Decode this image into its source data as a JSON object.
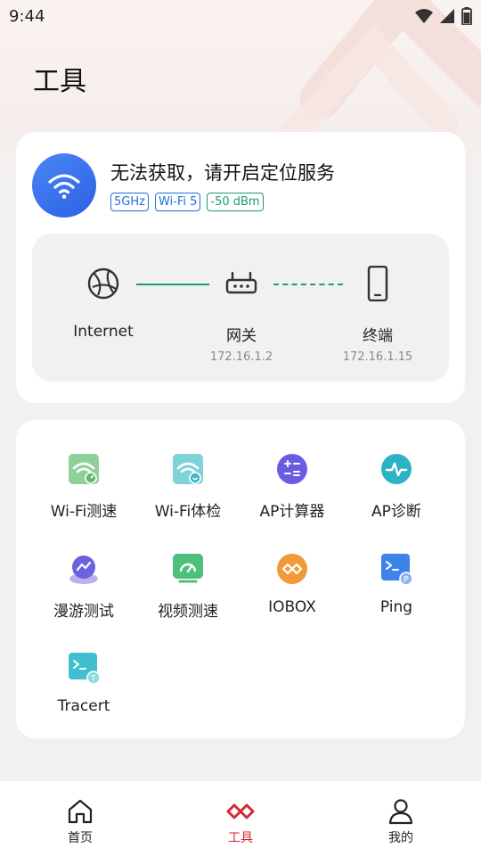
{
  "status_bar": {
    "time": "9:44"
  },
  "page": {
    "title": "工具"
  },
  "network": {
    "status_text": "无法获取，请开启定位服务",
    "badges": [
      "5GHz",
      "Wi-Fi 5",
      "-50 dBm"
    ],
    "topology": {
      "internet_label": "Internet",
      "gateway_label": "网关",
      "gateway_ip": "172.16.1.2",
      "terminal_label": "终端",
      "terminal_ip": "172.16.1.15"
    }
  },
  "tools": [
    {
      "label": "Wi-Fi测速",
      "icon": "wifi-speed-icon"
    },
    {
      "label": "Wi-Fi体检",
      "icon": "wifi-checkup-icon"
    },
    {
      "label": "AP计算器",
      "icon": "calculator-icon"
    },
    {
      "label": "AP诊断",
      "icon": "diagnosis-icon"
    },
    {
      "label": "漫游测试",
      "icon": "roaming-icon"
    },
    {
      "label": "视频测速",
      "icon": "video-speed-icon"
    },
    {
      "label": "IOBOX",
      "icon": "iobox-icon"
    },
    {
      "label": "Ping",
      "icon": "ping-icon"
    },
    {
      "label": "Tracert",
      "icon": "tracert-icon"
    }
  ],
  "bottom_nav": [
    {
      "label": "首页",
      "icon": "home-icon"
    },
    {
      "label": "工具",
      "icon": "tools-icon",
      "active": true
    },
    {
      "label": "我的",
      "icon": "profile-icon"
    }
  ],
  "colors": {
    "accent_red": "#d42a35",
    "link_green": "#179e74",
    "badge_blue": "#1e6fd9",
    "wifi_blue": "#2c61e4"
  }
}
